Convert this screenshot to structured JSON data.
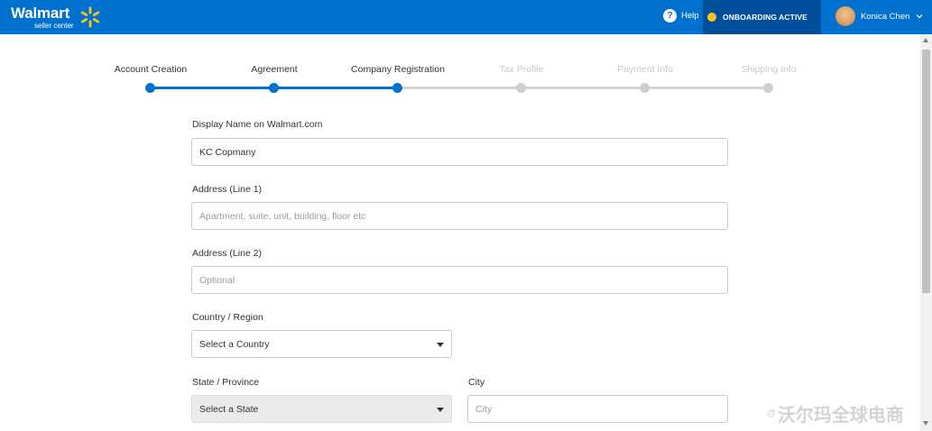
{
  "header": {
    "brand": "Walmart",
    "brand_sub": "seller center",
    "help_label": "Help",
    "status_label": "ONBOARDING ACTIVE",
    "user_name": "Konica Chen",
    "colors": {
      "bar": "#0071ce",
      "status_bg": "#004f9a",
      "status_dot": "#ffc220"
    }
  },
  "stepper": {
    "steps": [
      {
        "label": "Account Creation",
        "state": "complete"
      },
      {
        "label": "Agreement",
        "state": "complete"
      },
      {
        "label": "Company Registration",
        "state": "current"
      },
      {
        "label": "Tax Profile",
        "state": "upcoming"
      },
      {
        "label": "Payment Info",
        "state": "upcoming"
      },
      {
        "label": "Shipping Info",
        "state": "upcoming"
      }
    ]
  },
  "form": {
    "display_name": {
      "label": "Display Name on Walmart.com",
      "value": "KC Copmany"
    },
    "address1": {
      "label": "Address (Line 1)",
      "placeholder": "Apartment, suite, unit, building, floor etc"
    },
    "address2": {
      "label": "Address (Line 2)",
      "placeholder": "Optional"
    },
    "country": {
      "label": "Country / Region",
      "selected": "Select a Country"
    },
    "state": {
      "label": "State / Province",
      "selected": "Select a State"
    },
    "city": {
      "label": "City",
      "placeholder": "City"
    }
  },
  "watermark": {
    "at": "@",
    "text": "沃尔玛全球电商"
  }
}
